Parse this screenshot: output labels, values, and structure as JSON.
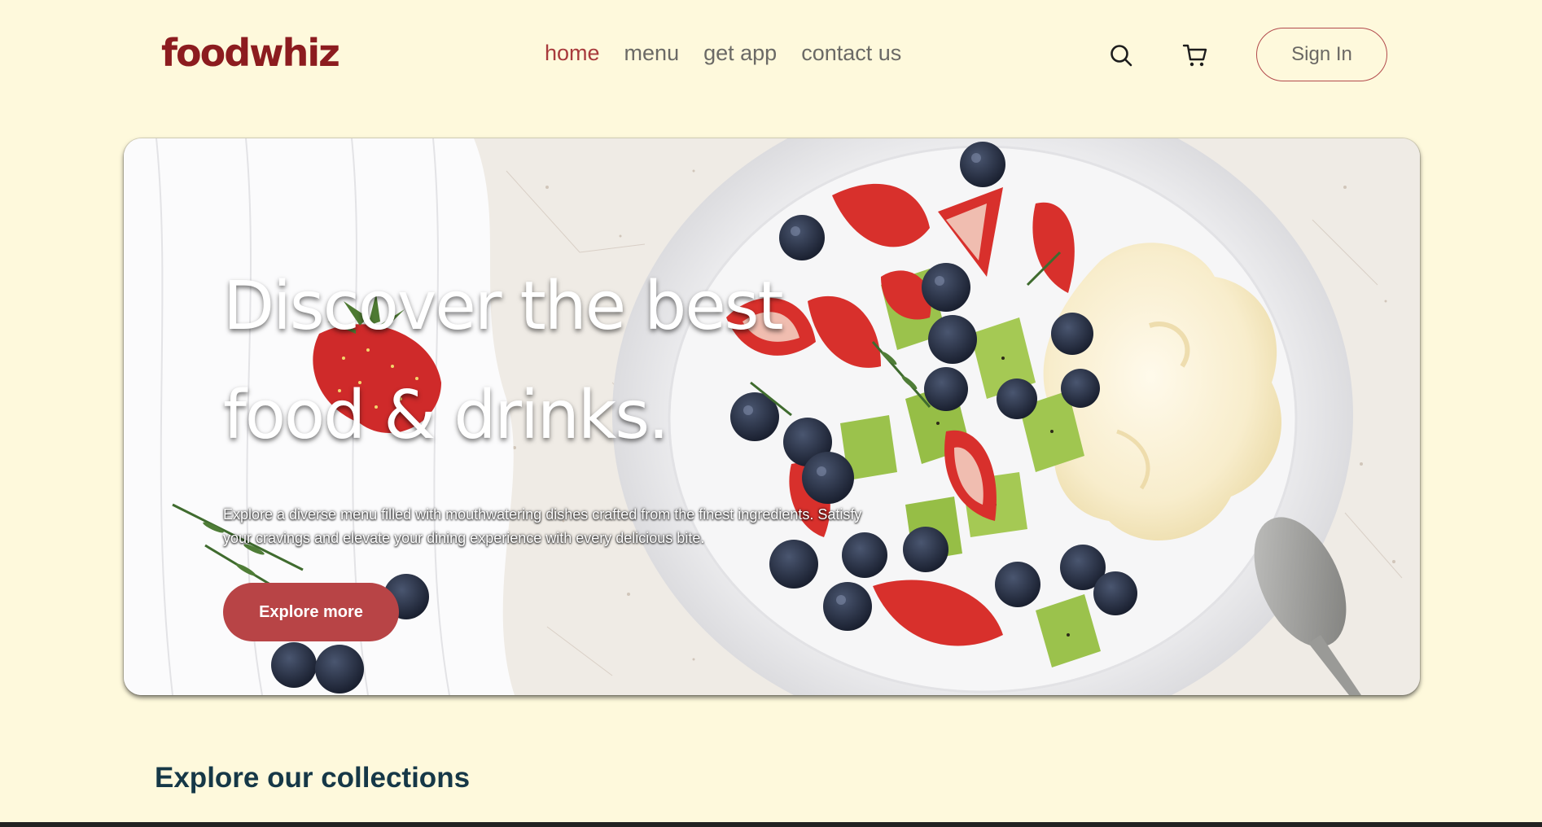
{
  "header": {
    "logo": "foodwhiz",
    "nav": [
      {
        "label": "home",
        "active": true
      },
      {
        "label": "menu",
        "active": false
      },
      {
        "label": "get app",
        "active": false
      },
      {
        "label": "contact us",
        "active": false
      }
    ],
    "search_icon": "search-icon",
    "cart_icon": "cart-icon",
    "signin_label": "Sign In"
  },
  "hero": {
    "title_line1": "Discover the best",
    "title_line2": "food & drinks.",
    "description": "Explore a diverse menu filled with mouthwatering dishes crafted from the finest ingredients. Satisfy your cravings and elevate your dining experience with every delicious bite.",
    "cta_label": "Explore more"
  },
  "collections": {
    "title": "Explore our collections"
  },
  "colors": {
    "background": "#fef9dc",
    "brand": "#8c1c1f",
    "accent": "#b84446",
    "nav_text": "#6b6a66",
    "heading": "#163847"
  }
}
